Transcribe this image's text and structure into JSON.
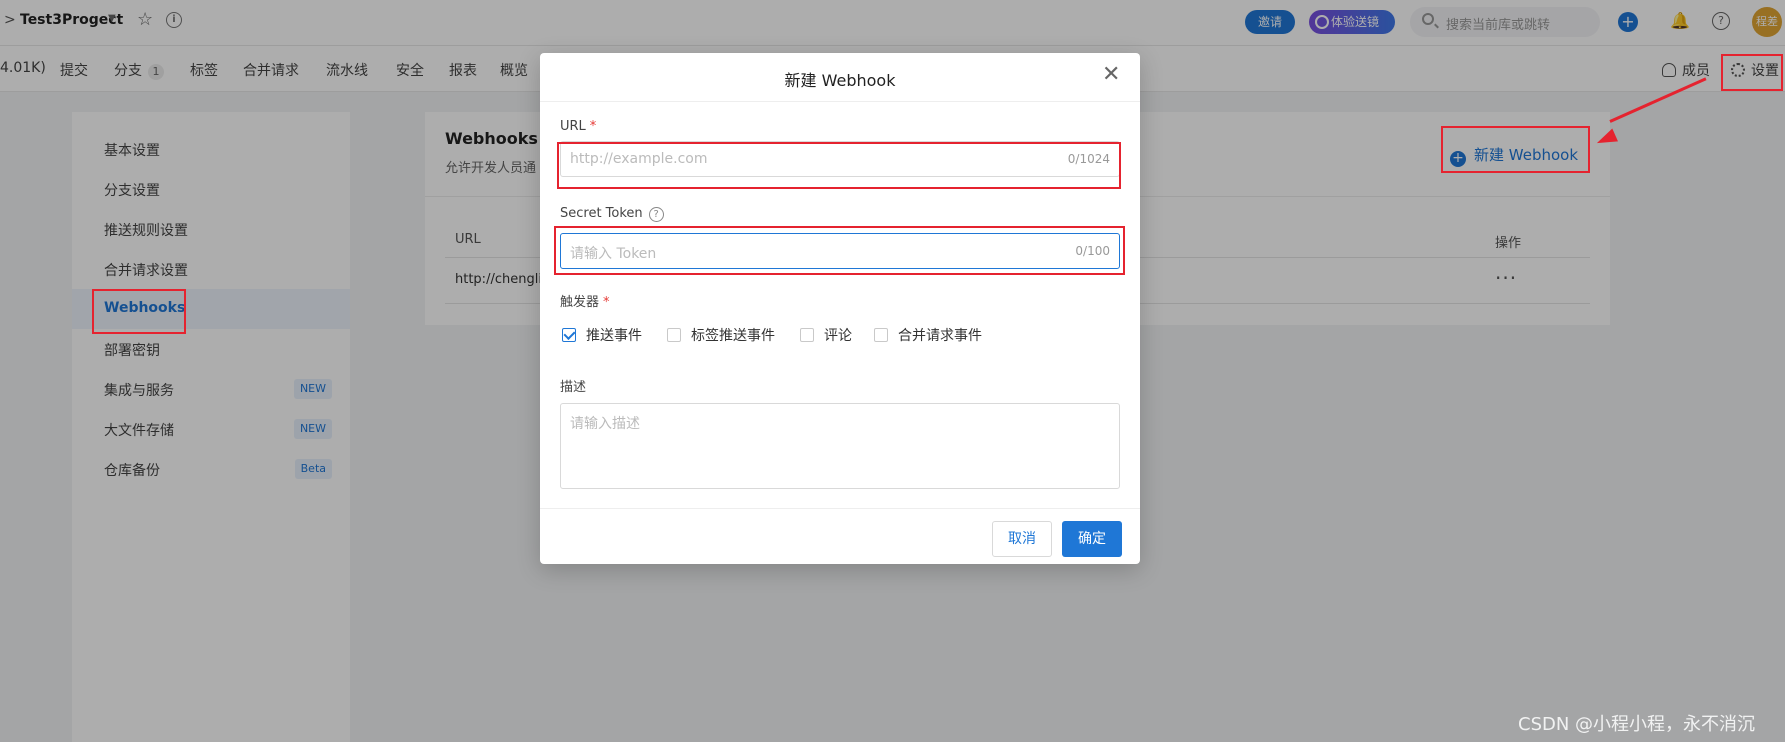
{
  "topbar": {
    "project_name": "Test3Progect",
    "invite_label": "邀请",
    "trial_label": "体验送镜",
    "search_placeholder": "搜索当前库或跳转",
    "avatar_text": "程差"
  },
  "nav": {
    "items": [
      {
        "label": "4.01K)"
      },
      {
        "label": "提交"
      },
      {
        "label": "分支",
        "badge": "1"
      },
      {
        "label": "标签"
      },
      {
        "label": "合并请求"
      },
      {
        "label": "流水线"
      },
      {
        "label": "安全"
      },
      {
        "label": "报表"
      },
      {
        "label": "概览"
      }
    ],
    "members_label": "成员",
    "settings_label": "设置"
  },
  "sidebar": {
    "items": [
      {
        "label": "基本设置"
      },
      {
        "label": "分支设置"
      },
      {
        "label": "推送规则设置"
      },
      {
        "label": "合并请求设置"
      },
      {
        "label": "Webhooks",
        "active": true
      },
      {
        "label": "部署密钥"
      },
      {
        "label": "集成与服务",
        "tag": "NEW"
      },
      {
        "label": "大文件存储",
        "tag": "NEW"
      },
      {
        "label": "仓库备份",
        "tag": "Beta"
      }
    ]
  },
  "content": {
    "title": "Webhooks",
    "description": "允许开发人员通",
    "new_webhook_label": "新建 Webhook",
    "table": {
      "headers": {
        "url": "URL",
        "actions": "操作"
      },
      "rows": [
        {
          "url": "http://chengli",
          "actions": "···"
        }
      ]
    }
  },
  "modal": {
    "title": "新建 Webhook",
    "url_label": "URL",
    "required_mark": "*",
    "url_placeholder": "http://example.com",
    "url_counter": "0/1024",
    "token_label": "Secret Token",
    "token_placeholder": "请输入 Token",
    "token_counter": "0/100",
    "trigger_label": "触发器",
    "triggers": [
      {
        "label": "推送事件",
        "checked": true
      },
      {
        "label": "标签推送事件",
        "checked": false
      },
      {
        "label": "评论",
        "checked": false
      },
      {
        "label": "合并请求事件",
        "checked": false
      }
    ],
    "description_label": "描述",
    "description_placeholder": "请输入描述",
    "cancel_label": "取消",
    "ok_label": "确定"
  },
  "watermark": "CSDN @小程小程，永不消沉",
  "colors": {
    "accent": "#1f77d6",
    "annotation": "#e5232f",
    "required": "#e53935"
  }
}
